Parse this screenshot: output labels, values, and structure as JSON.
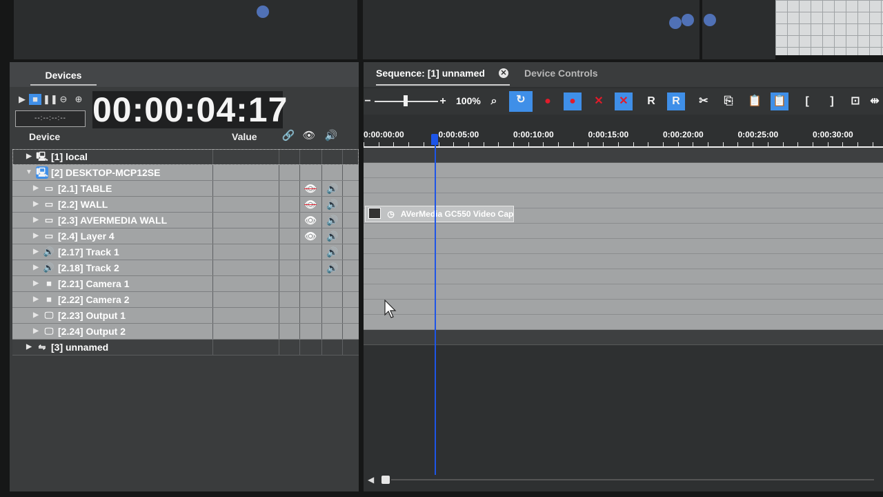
{
  "left_panel": {
    "tab": "Devices",
    "timecode": "00:00:04:17",
    "scrubber": "--:--:--:--",
    "columns": {
      "device": "Device",
      "value": "Value"
    },
    "transport_icons": [
      "play-icon",
      "stop-icon",
      "pause-icon",
      "zoom-out-icon",
      "zoom-in-icon"
    ],
    "header_icons": [
      "link-icon",
      "eye-icon",
      "speaker-icon"
    ],
    "rows": [
      {
        "label": "[1] local",
        "icon": "computer-icon",
        "level": 0,
        "arrow": "▶",
        "style": "dark"
      },
      {
        "label": "[2] DESKTOP-MCP12SE",
        "icon": "computer-error-icon",
        "level": 0,
        "arrow": "▼",
        "style": "light"
      },
      {
        "label": "[2.1] TABLE",
        "icon": "screen-icon",
        "level": 1,
        "arrow": "▶",
        "style": "light",
        "visibility": "hidden",
        "audio": true
      },
      {
        "label": "[2.2] WALL",
        "icon": "screen-icon",
        "level": 1,
        "arrow": "▶",
        "style": "light",
        "visibility": "hidden",
        "audio": true
      },
      {
        "label": "[2.3] AVERMEDIA WALL",
        "icon": "screen-icon",
        "level": 1,
        "arrow": "▶",
        "style": "light",
        "visibility": "visible",
        "audio": true
      },
      {
        "label": "[2.4] Layer 4",
        "icon": "screen-icon",
        "level": 1,
        "arrow": "▶",
        "style": "light",
        "visibility": "visible",
        "audio": true
      },
      {
        "label": "[2.17] Track 1",
        "icon": "speaker-icon",
        "level": 1,
        "arrow": "▶",
        "style": "light",
        "audio": true
      },
      {
        "label": "[2.18] Track 2",
        "icon": "speaker-icon",
        "level": 1,
        "arrow": "▶",
        "style": "light",
        "audio": true
      },
      {
        "label": "[2.21] Camera 1",
        "icon": "camera-icon",
        "level": 1,
        "arrow": "▶",
        "style": "light"
      },
      {
        "label": "[2.22] Camera 2",
        "icon": "camera-icon",
        "level": 1,
        "arrow": "▶",
        "style": "light"
      },
      {
        "label": "[2.23] Output 1",
        "icon": "monitor-icon",
        "level": 1,
        "arrow": "▶",
        "style": "light"
      },
      {
        "label": "[2.24] Output 2",
        "icon": "monitor-icon",
        "level": 1,
        "arrow": "▶",
        "style": "light"
      },
      {
        "label": "[3] unnamed",
        "icon": "network-icon",
        "level": 0,
        "arrow": "▶",
        "style": "dark"
      }
    ]
  },
  "right_panel": {
    "tabs": {
      "sequence": "Sequence: [1] unnamed",
      "device_controls": "Device Controls"
    },
    "zoom_percent": "100%",
    "toolbar_icons": [
      "zoom-minus-icon",
      "zoom-slider",
      "zoom-plus-icon",
      "zoom-fit-icon",
      "snap-icon",
      "record-icon",
      "record-active-icon",
      "delete-icon",
      "delete-active-icon",
      "r-icon",
      "r-active-icon",
      "scissors-icon",
      "copy-icon",
      "paste-icon",
      "paste-active-icon",
      "mark-in-icon",
      "mark-out-icon",
      "frame-icon",
      "split-icon"
    ],
    "toolbar_letters": {
      "r": "R",
      "mark_in": "[",
      "mark_out": "]"
    },
    "ruler_labels": [
      "0:00:00:00",
      "0:00:05:00",
      "0:00:10:00",
      "0:00:15:00",
      "0:00:20:00",
      "0:00:25:00",
      "0:00:30:00"
    ],
    "clip_label": "AVerMedia GC550 Video Cap"
  },
  "colors": {
    "accent": "#3f8fe8",
    "playhead": "#1d55e8",
    "record": "#e21b2a"
  }
}
